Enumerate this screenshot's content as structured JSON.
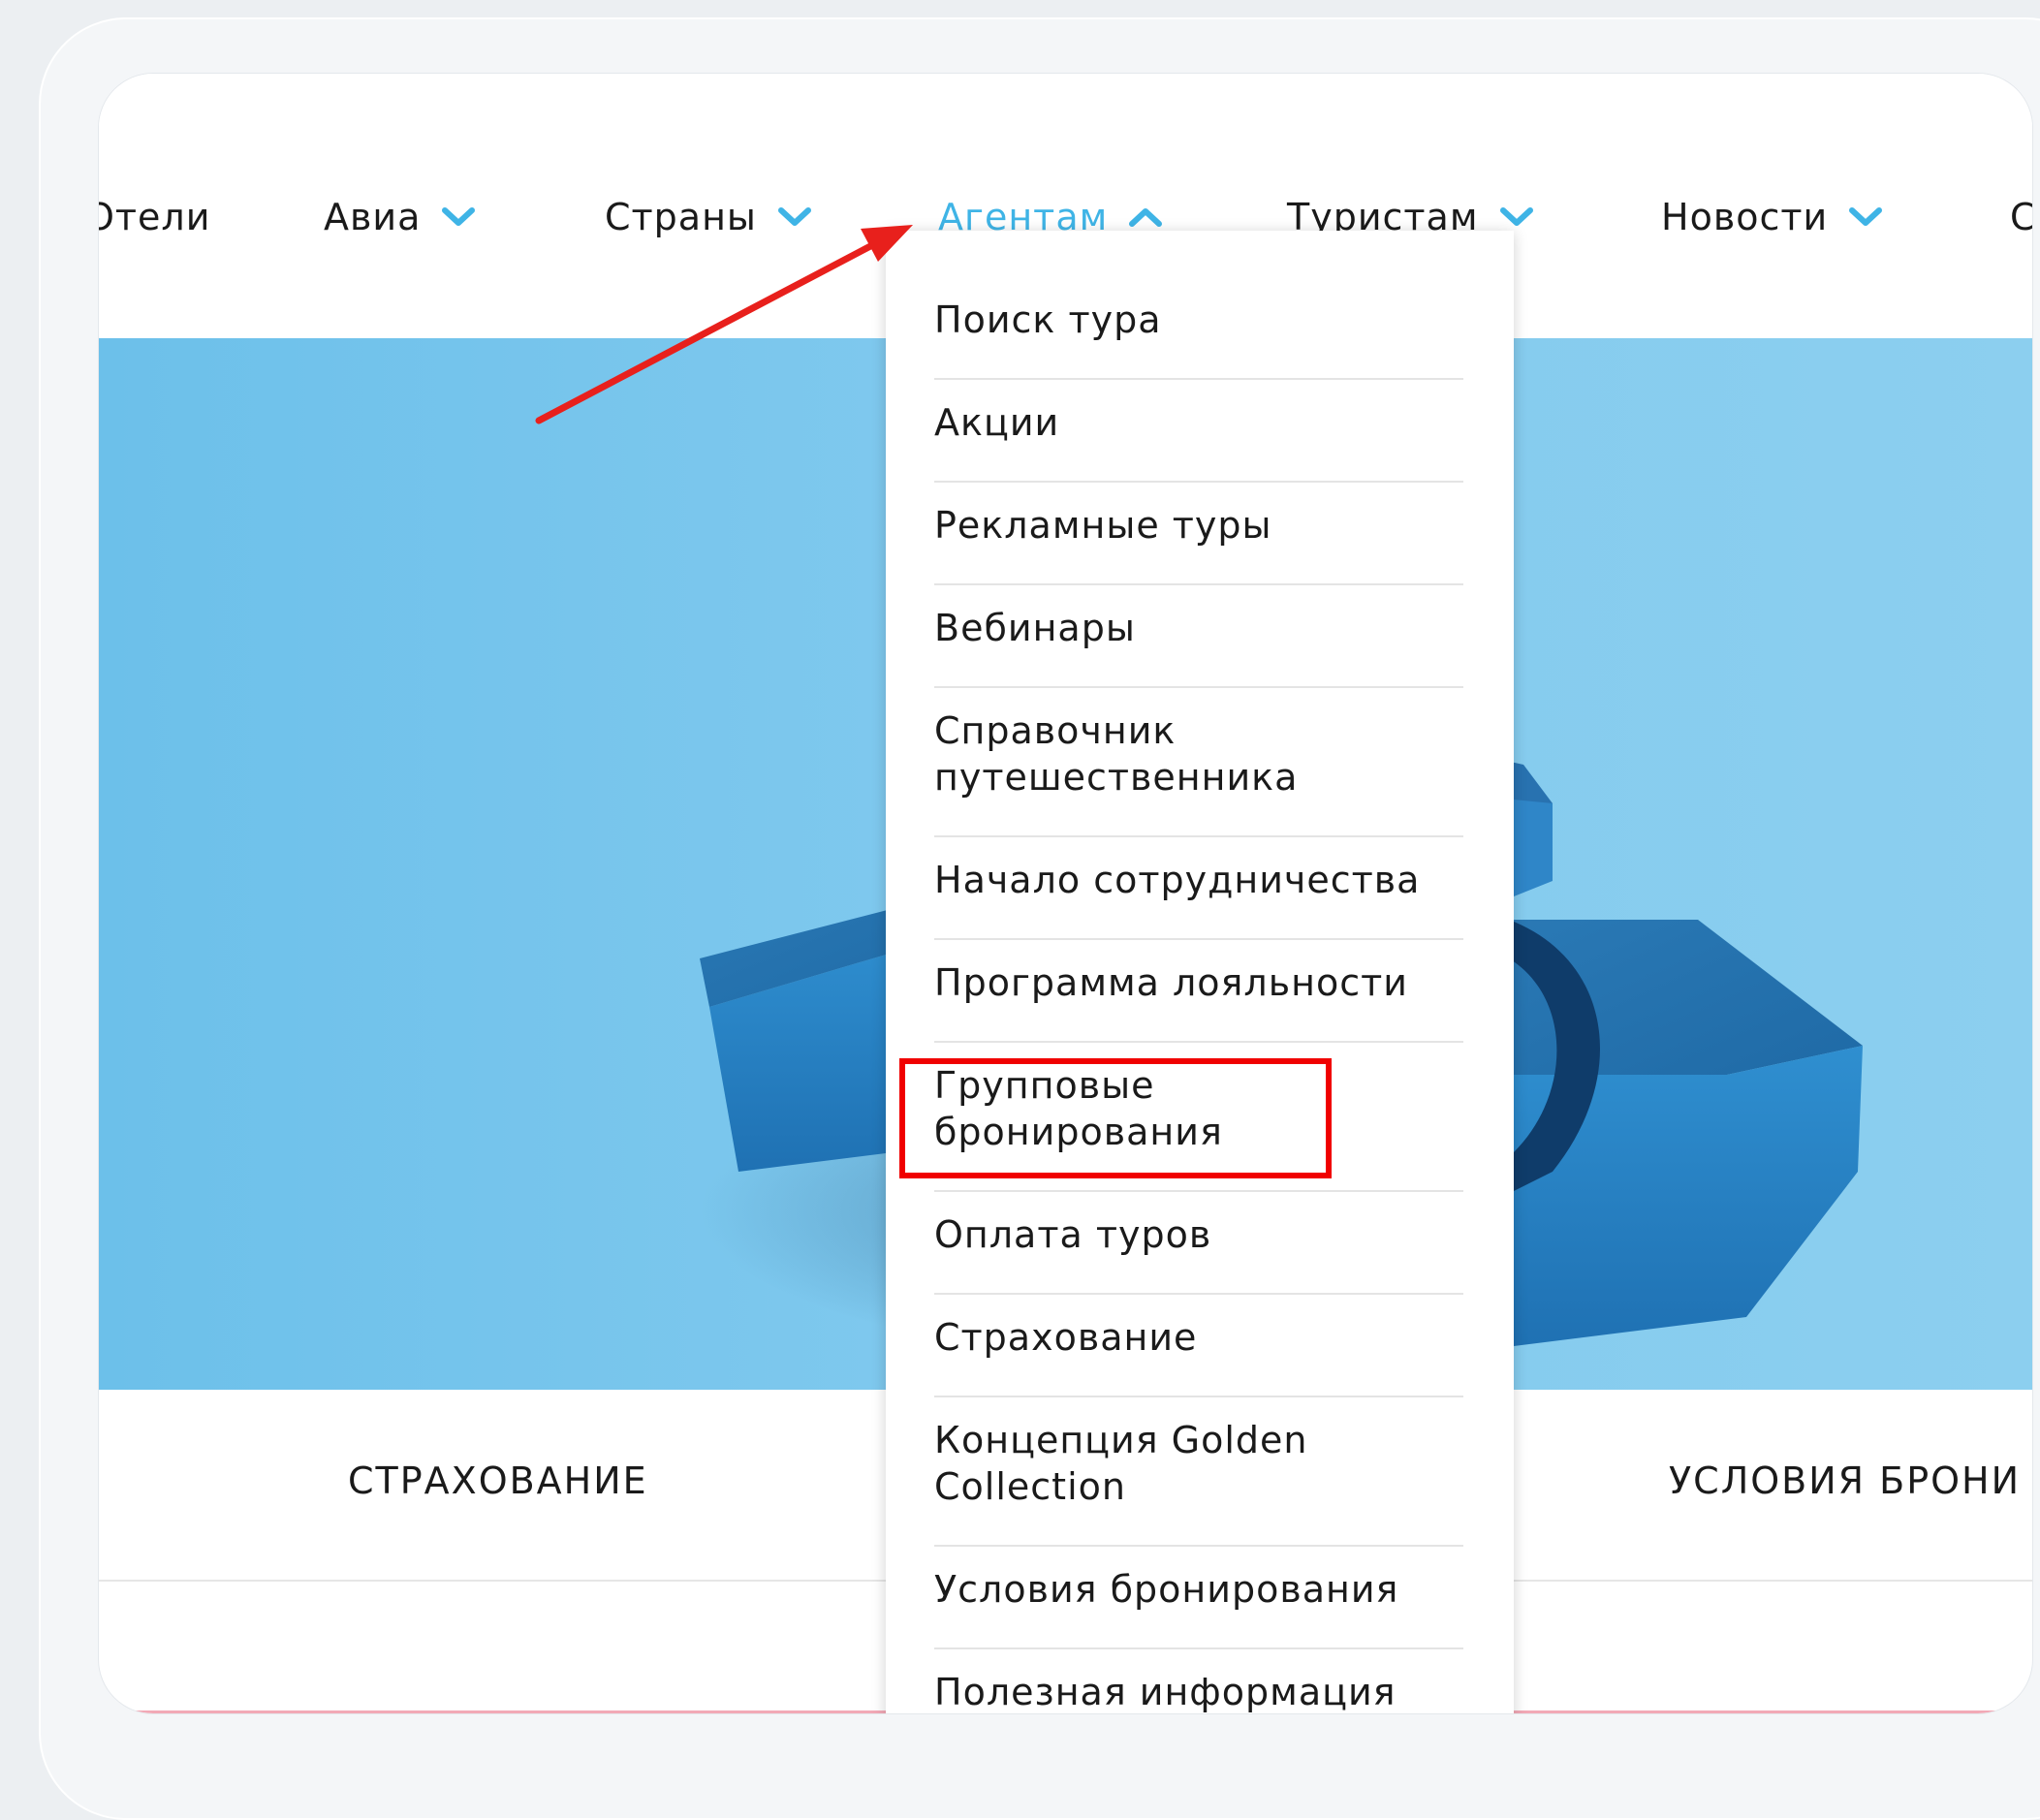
{
  "nav": {
    "items": [
      {
        "label": "Отели",
        "dropdown": false,
        "active": false
      },
      {
        "label": "Авиа",
        "dropdown": true,
        "active": false
      },
      {
        "label": "Страны",
        "dropdown": true,
        "active": false
      },
      {
        "label": "Агентам",
        "dropdown": true,
        "active": true
      },
      {
        "label": "Туристам",
        "dropdown": true,
        "active": false
      },
      {
        "label": "Новости",
        "dropdown": true,
        "active": false
      },
      {
        "label": "С",
        "dropdown": false,
        "active": false
      }
    ]
  },
  "dropdown": {
    "items": [
      "Поиск тура",
      "Акции",
      "Рекламные туры",
      "Вебинары",
      "Справочник путешественника",
      "Начало сотрудничества",
      "Программа лояльности",
      "Групповые бронирования",
      "Оплата туров",
      "Страхование",
      "Концепция Golden Collection",
      "Условия бронирования",
      "Полезная информация"
    ],
    "highlighted_index": 7
  },
  "bottom": {
    "left_label": "СТРАХОВАНИЕ",
    "right_label": "УСЛОВИЯ БРОНИ"
  },
  "colors": {
    "active_nav": "#3fb4e6",
    "chevron": "#3fb4e6",
    "hero_blue": "#7ac6ec",
    "highlight_red": "#f00000",
    "arrow_red": "#e8201c"
  },
  "icons": {
    "chevron_down": "chevron-down-icon",
    "chevron_up": "chevron-up-icon"
  }
}
